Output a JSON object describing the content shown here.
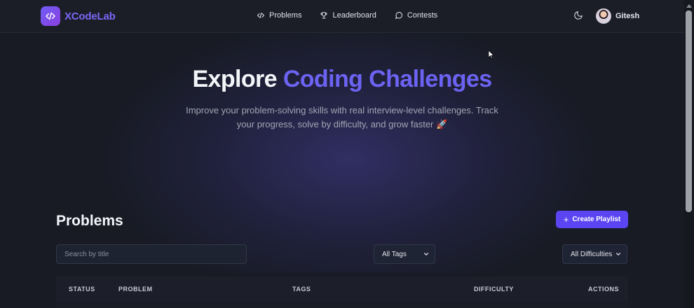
{
  "brand": {
    "name": "XCodeLab",
    "logo_icon": "code-icon",
    "accent": "#6c63f2",
    "button": "#5b44f2"
  },
  "nav": {
    "items": [
      {
        "label": "Problems",
        "icon": "code-icon"
      },
      {
        "label": "Leaderboard",
        "icon": "trophy-icon"
      },
      {
        "label": "Contests",
        "icon": "chat-bubble-icon"
      }
    ],
    "theme_icon": "moon-icon",
    "user": {
      "name": "Gitesh"
    }
  },
  "hero": {
    "title_plain": "Explore ",
    "title_accent": "Coding Challenges",
    "subtitle_line1": "Improve your problem-solving skills with real interview-level challenges. Track",
    "subtitle_line2": "your progress, solve by difficulty, and grow faster 🚀"
  },
  "problems": {
    "title": "Problems",
    "create_label": "Create Playlist",
    "search_placeholder": "Search by title",
    "tags_filter": "All Tags",
    "difficulty_filter": "All Difficulties",
    "columns": [
      "STATUS",
      "PROBLEM",
      "TAGS",
      "DIFFICULTY",
      "ACTIONS"
    ]
  }
}
